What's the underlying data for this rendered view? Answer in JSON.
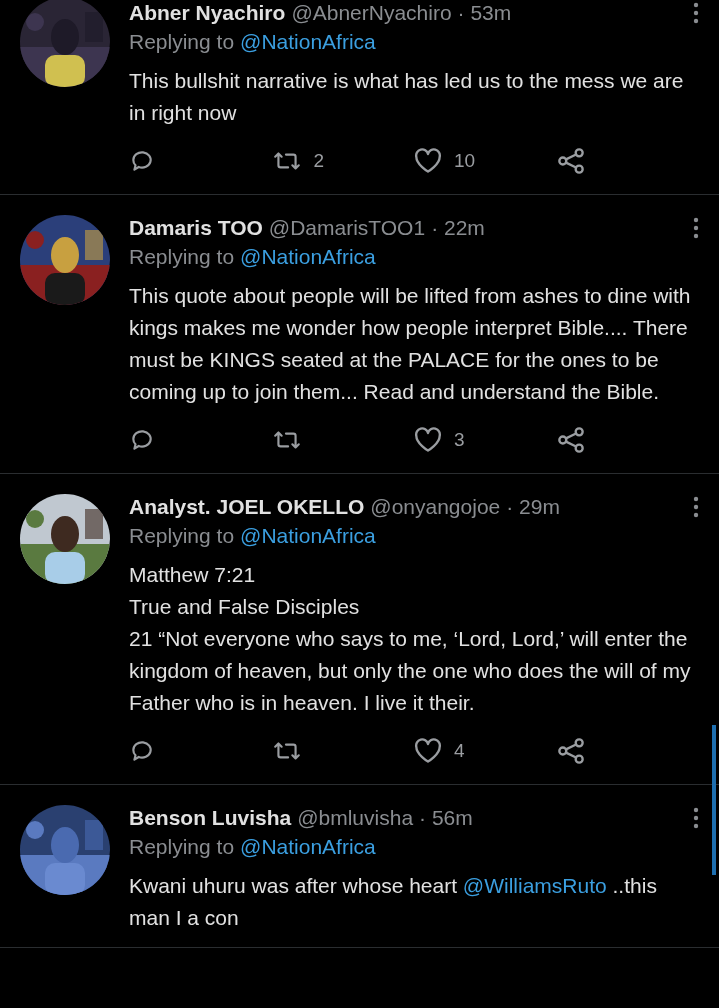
{
  "tweets": [
    {
      "name": "Abner Nyachiro",
      "handle": "@AbnerNyachiro",
      "time": "· 53m",
      "replying_label": "Replying to",
      "replying_to": "@NationAfrica",
      "body": [
        {
          "text": "This bullshit narrative is what has led us to the mess we are in right now"
        }
      ],
      "retweets": "2",
      "likes": "10"
    },
    {
      "name": "Damaris TOO",
      "handle": "@DamarisTOO1",
      "time": "· 22m",
      "replying_label": "Replying to",
      "replying_to": "@NationAfrica",
      "body": [
        {
          "text": "This quote about people will be lifted from ashes to dine with kings makes me wonder how people interpret Bible.... There must be KINGS seated at the PALACE for the ones to be coming up to join them... Read and understand the Bible."
        }
      ],
      "likes": "3"
    },
    {
      "name": "Analyst. JOEL OKELLO",
      "handle": "@onyangojoe",
      "time": "· 29m",
      "replying_label": "Replying to",
      "replying_to": "@NationAfrica",
      "body": [
        {
          "text": "Matthew 7:21\nTrue and False Disciples\n21 “Not everyone who says to me, ‘Lord, Lord,’ will enter the kingdom of heaven, but only the one who does the will of my Father who is in heaven. I live it their."
        }
      ],
      "likes": "4"
    },
    {
      "name": "Benson Luvisha",
      "handle": "@bmluvisha",
      "time": "· 56m",
      "replying_label": "Replying to",
      "replying_to": "@NationAfrica",
      "body": [
        {
          "text": "Kwani uhuru was after whose heart "
        },
        {
          "text": "@WilliamsRuto",
          "kind": "mention"
        },
        {
          "text": " ..this man I a con"
        }
      ]
    }
  ]
}
